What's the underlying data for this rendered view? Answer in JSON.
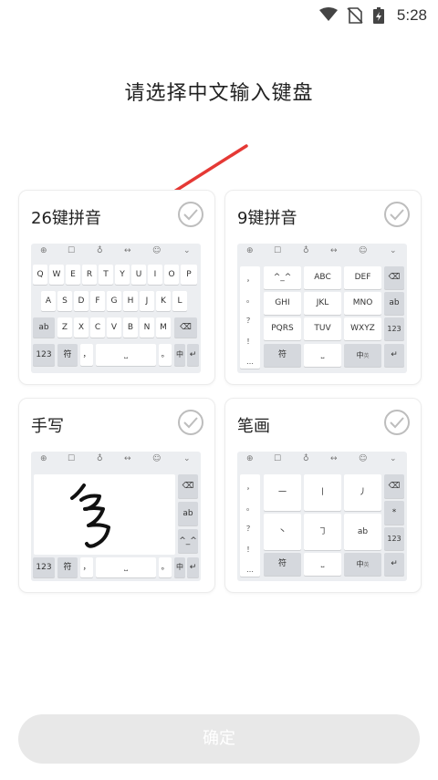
{
  "status_bar": {
    "time": "5:28"
  },
  "title": "请选择中文输入键盘",
  "options": [
    {
      "label": "26键拼音",
      "checked": false
    },
    {
      "label": "9键拼音",
      "checked": false
    },
    {
      "label": "手写",
      "checked": false
    },
    {
      "label": "笔画",
      "checked": false
    }
  ],
  "kb26": {
    "row1": [
      "Q",
      "W",
      "E",
      "R",
      "T",
      "Y",
      "U",
      "I",
      "O",
      "P"
    ],
    "row2": [
      "A",
      "S",
      "D",
      "F",
      "G",
      "H",
      "J",
      "K",
      "L"
    ],
    "row3": [
      "Z",
      "X",
      "C",
      "V",
      "B",
      "N",
      "M"
    ],
    "shift": "ab",
    "num": "123",
    "sym": "符",
    "comma": "，",
    "period": "。",
    "lang": "中",
    "lang_sub": "英"
  },
  "kb9": {
    "side": [
      "，",
      "。",
      "？",
      "！",
      "…"
    ],
    "keys": [
      "^_^",
      "ABC",
      "DEF",
      "GHI",
      "JKL",
      "MNO",
      "PQRS",
      "TUV",
      "WXYZ"
    ],
    "right": [
      "ab",
      "123"
    ],
    "sym": "符",
    "lang": "中",
    "lang_sub": "英"
  },
  "kbhw": {
    "right": [
      "ab",
      "^_^"
    ],
    "num": "123",
    "sym": "符",
    "comma": "，",
    "period": "。",
    "lang": "中",
    "lang_sub": "英"
  },
  "kbstroke": {
    "side": [
      "，",
      "。",
      "？",
      "！",
      "…"
    ],
    "keys": [
      "一",
      "丨",
      "丿",
      "丶",
      "㇆",
      "ab"
    ],
    "right": [
      "*",
      "123"
    ],
    "sym": "符",
    "lang": "中",
    "lang_sub": "英"
  },
  "confirm_label": "确定",
  "colors": {
    "arrow": "#e53935",
    "disabled_button": "#e8e8e8",
    "keyboard_bg": "#eceef1"
  }
}
